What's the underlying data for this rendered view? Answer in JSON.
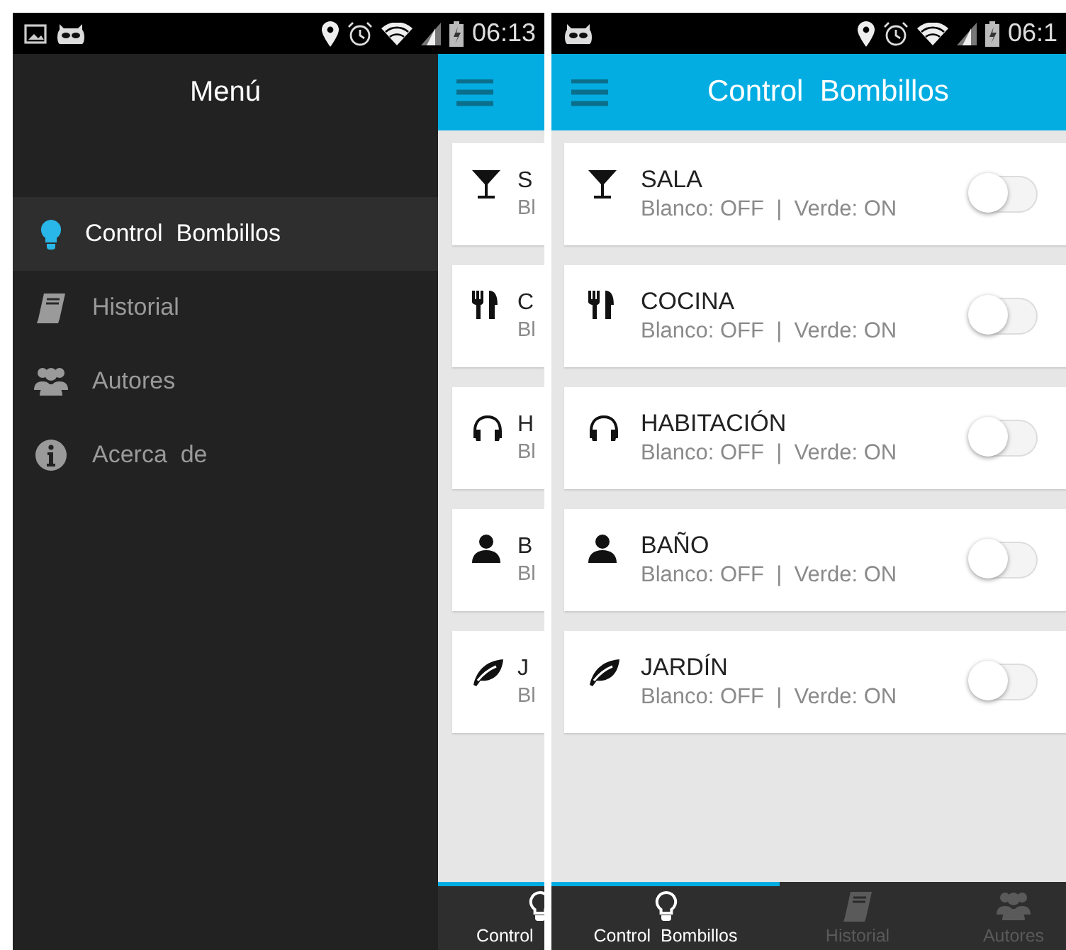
{
  "screens": [
    {
      "kind": "drawer",
      "status_bar": {
        "time": "06:13"
      },
      "drawer": {
        "title": "Menú",
        "items": [
          {
            "label": "Control  Bombillos",
            "selected": true
          },
          {
            "label": "Historial",
            "selected": false
          },
          {
            "label": "Autores",
            "selected": false
          },
          {
            "label": "Acerca  de",
            "selected": false
          }
        ]
      },
      "background_app": {
        "rooms": [
          {
            "name": "S",
            "detail": "Bl"
          },
          {
            "name": "C",
            "detail": "Bl"
          },
          {
            "name": "H",
            "detail": "Bl"
          },
          {
            "name": "B",
            "detail": "Bl"
          },
          {
            "name": "J",
            "detail": "Bl"
          }
        ],
        "tab_label": "Control"
      }
    },
    {
      "kind": "main",
      "status_bar": {
        "time": "06:1"
      },
      "toolbar": {
        "title": "Control  Bombillos"
      },
      "rooms": [
        {
          "name": "SALA",
          "detail": "Blanco: OFF  |  Verde: ON",
          "on": false
        },
        {
          "name": "COCINA",
          "detail": "Blanco: OFF  |  Verde: ON",
          "on": false
        },
        {
          "name": "HABITACIÓN",
          "detail": "Blanco: OFF  |  Verde: ON",
          "on": false
        },
        {
          "name": "BAÑO",
          "detail": "Blanco: OFF  |  Verde: ON",
          "on": false
        },
        {
          "name": "JARDÍN",
          "detail": "Blanco: OFF  |  Verde: ON",
          "on": false
        }
      ],
      "tabs": [
        {
          "label": "Control  Bombillos",
          "selected": true
        },
        {
          "label": "Historial",
          "selected": false
        },
        {
          "label": "Autores",
          "selected": false
        }
      ]
    }
  ]
}
